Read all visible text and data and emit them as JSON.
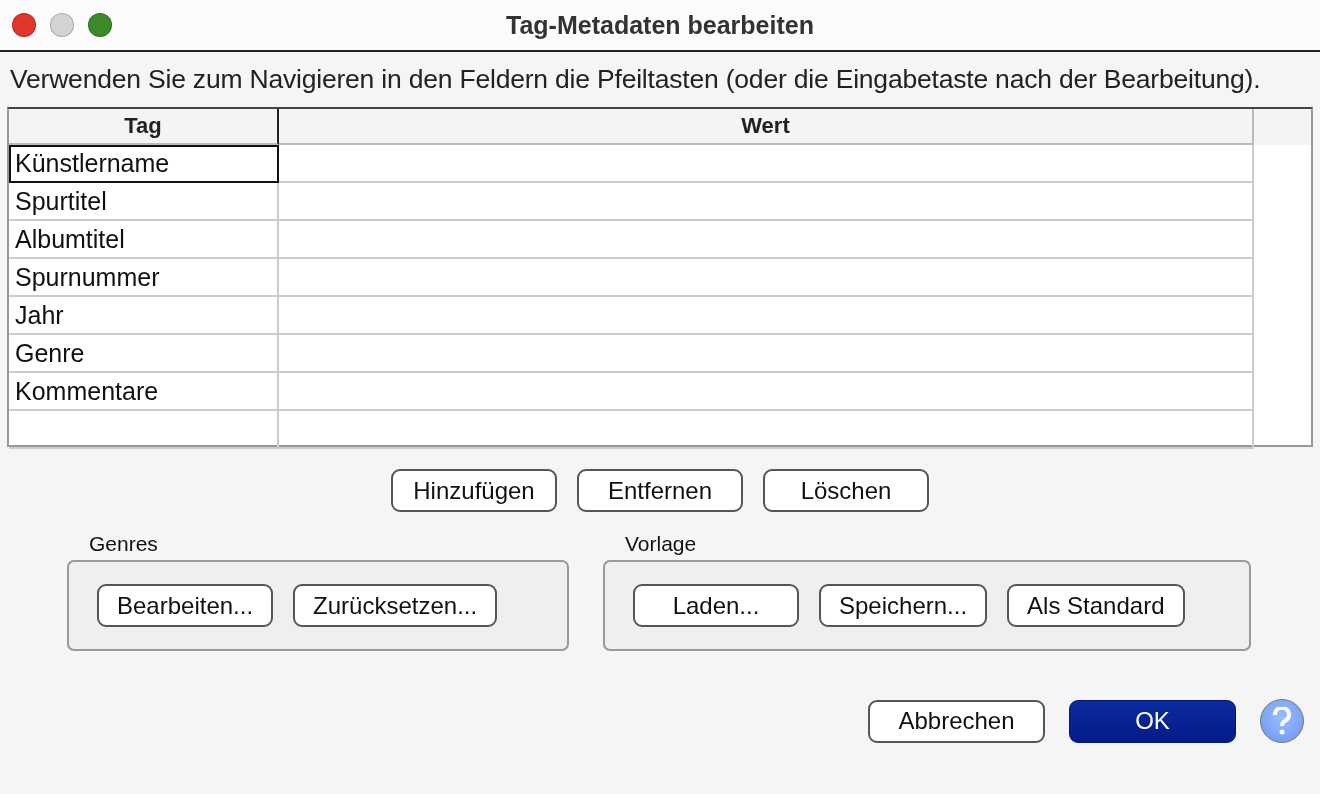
{
  "window": {
    "title": "Tag-Metadaten bearbeiten"
  },
  "instruction": "Verwenden Sie zum Navigieren in den Feldern die Pfeiltasten (oder die Eingabetaste nach der Bearbeitung).",
  "table": {
    "columns": [
      "Tag",
      "Wert"
    ],
    "rows": [
      {
        "tag": "Künstlername",
        "selected": true
      },
      {
        "tag": "Spurtitel",
        "selected": false
      },
      {
        "tag": "Albumtitel",
        "selected": false
      },
      {
        "tag": "Spurnummer",
        "selected": false
      },
      {
        "tag": "Jahr",
        "selected": false
      },
      {
        "tag": "Genre",
        "selected": false
      },
      {
        "tag": "Kommentare",
        "selected": false
      }
    ]
  },
  "row_buttons": [
    "Hinzufügen",
    "Entfernen",
    "Löschen"
  ],
  "groups": [
    {
      "title": "Genres",
      "buttons": [
        "Bearbeiten...",
        "Zurücksetzen..."
      ]
    },
    {
      "title": "Vorlage",
      "buttons": [
        "Laden...",
        "Speichern...",
        "Als Standard"
      ]
    }
  ],
  "footer_buttons": [
    {
      "label": "Abbrechen",
      "default": false
    },
    {
      "label": "OK",
      "default": true
    }
  ]
}
